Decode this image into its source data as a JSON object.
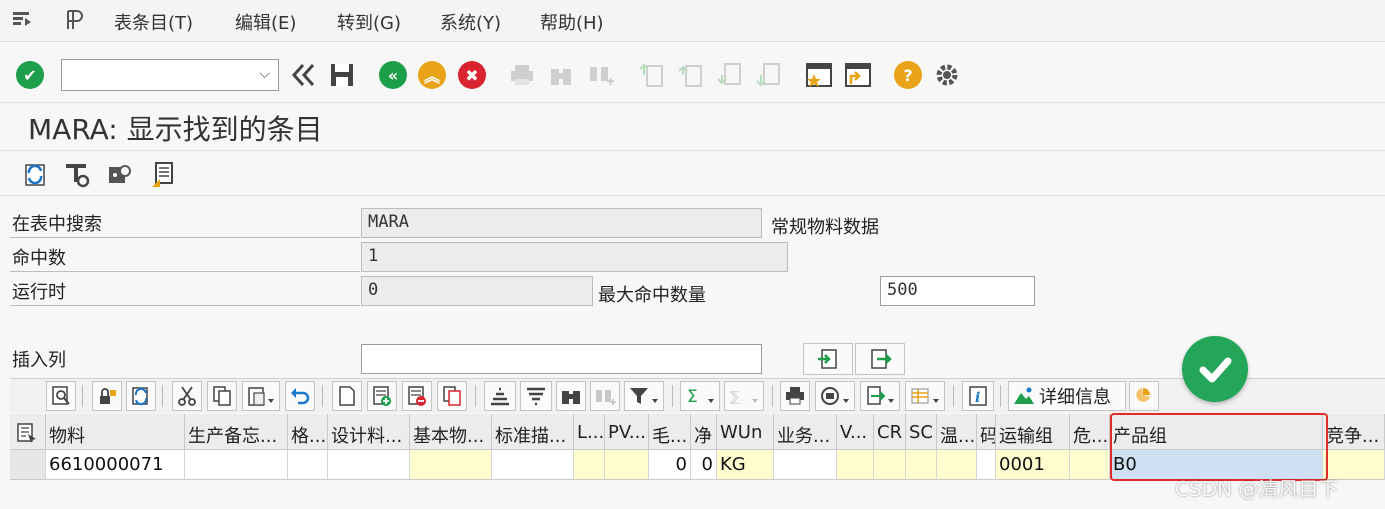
{
  "menu": {
    "items": [
      "表条目(T)",
      "编辑(E)",
      "转到(G)",
      "系统(Y)",
      "帮助(H)"
    ]
  },
  "toolbar": {
    "command_value": "",
    "icons": [
      "enter-check-icon",
      "command-dropdown",
      "rewind-icon",
      "save-icon",
      "back-icon",
      "exit-icon",
      "cancel-icon",
      "print-icon",
      "find-icon",
      "find-next-icon",
      "first-page-icon",
      "prev-page-icon",
      "next-page-icon",
      "last-page-icon",
      "create-session-icon",
      "shortcut-icon",
      "help-icon",
      "settings-gear-icon"
    ]
  },
  "title": "MARA: 显示找到的条目",
  "form": {
    "search_table_label": "在表中搜索",
    "search_table_value": "MARA",
    "search_table_desc": "常规物料数据",
    "hits_label": "命中数",
    "hits_value": "1",
    "runtime_label": "运行时",
    "runtime_value": "0",
    "max_hits_label": "最大命中数量",
    "max_hits_value": "500",
    "insert_col_label": "插入列",
    "insert_col_value": ""
  },
  "grid_toolbar": {
    "details_label": "详细信息"
  },
  "grid": {
    "headers": [
      "物料",
      "生产备忘...",
      "格...",
      "设计料...",
      "基本物...",
      "标准描...",
      "L...",
      "PV...",
      "毛...",
      "净",
      "WUn",
      "业务...",
      "V...",
      "CR",
      "SC",
      "温...",
      "码",
      "运输组",
      "危...",
      "产品组",
      "竞争..."
    ],
    "row": [
      "6610000071",
      "",
      "",
      "",
      "",
      "",
      "",
      "",
      "0",
      "0",
      "KG",
      "",
      "",
      "",
      "",
      "",
      "",
      "0001",
      "",
      "B0",
      ""
    ]
  },
  "watermark": "CSDN @清风目下",
  "colors": {
    "accent_green": "#23a55a",
    "highlight_red": "#e02b2b",
    "cell_yellow": "#fffdd0",
    "selected_blue": "#cfe0f3"
  }
}
